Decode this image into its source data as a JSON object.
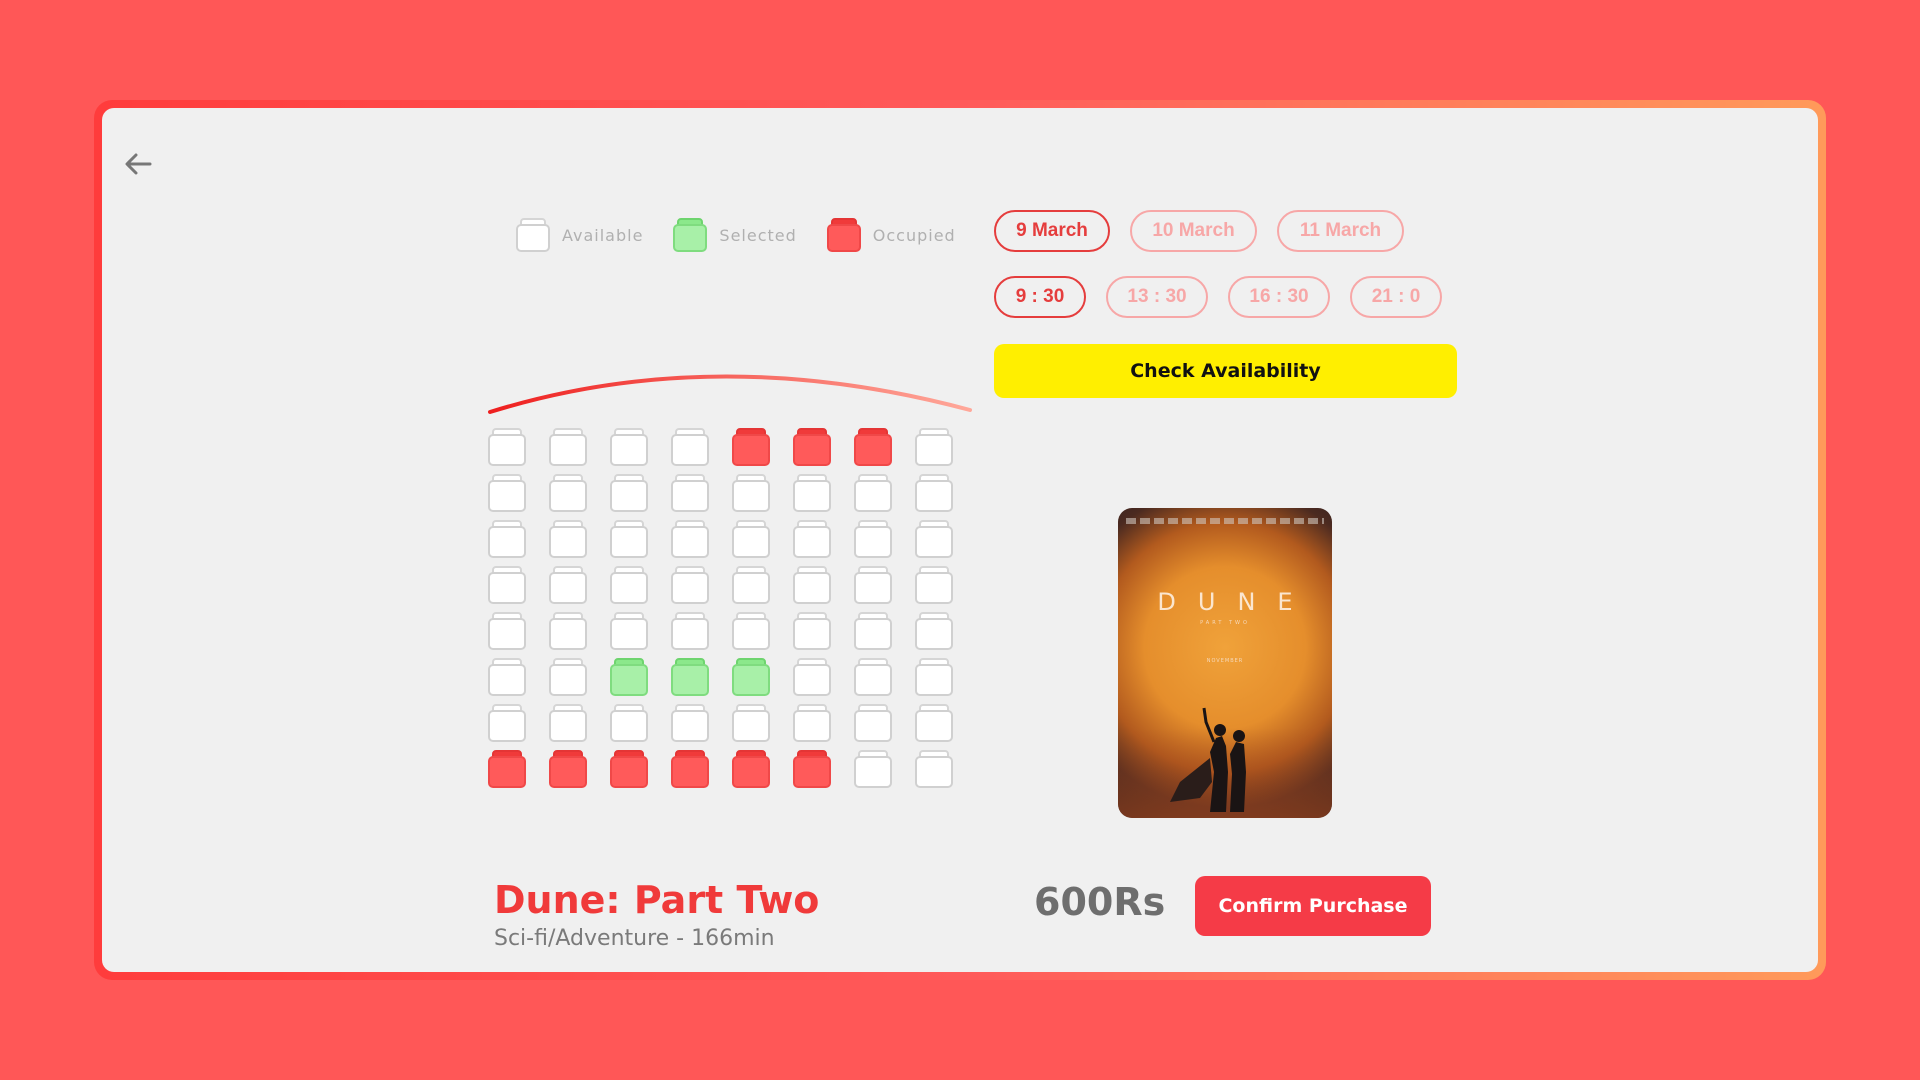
{
  "legend": {
    "available": "Available",
    "selected": "Selected",
    "occupied": "Occupied"
  },
  "dates": [
    {
      "label": "9 March",
      "active": true
    },
    {
      "label": "10 March",
      "active": false
    },
    {
      "label": "11 March",
      "active": false
    }
  ],
  "times": [
    {
      "label": "9 : 30",
      "active": true
    },
    {
      "label": "13 : 30",
      "active": false
    },
    {
      "label": "16 : 30",
      "active": false
    },
    {
      "label": "21 : 0",
      "active": false
    }
  ],
  "check_availability_label": "Check Availability",
  "seats": [
    [
      "available",
      "available",
      "available",
      "available",
      "occupied",
      "occupied",
      "occupied",
      "available"
    ],
    [
      "available",
      "available",
      "available",
      "available",
      "available",
      "available",
      "available",
      "available"
    ],
    [
      "available",
      "available",
      "available",
      "available",
      "available",
      "available",
      "available",
      "available"
    ],
    [
      "available",
      "available",
      "available",
      "available",
      "available",
      "available",
      "available",
      "available"
    ],
    [
      "available",
      "available",
      "available",
      "available",
      "available",
      "available",
      "available",
      "available"
    ],
    [
      "available",
      "available",
      "selected",
      "selected",
      "selected",
      "available",
      "available",
      "available"
    ],
    [
      "available",
      "available",
      "available",
      "available",
      "available",
      "available",
      "available",
      "available"
    ],
    [
      "occupied",
      "occupied",
      "occupied",
      "occupied",
      "occupied",
      "occupied",
      "available",
      "available"
    ]
  ],
  "poster": {
    "title": "DUNE",
    "subtitle": "PART TWO",
    "date_text": "NOVEMBER"
  },
  "movie": {
    "title": "Dune: Part Two",
    "meta": "Sci-fi/Adventure - 166min"
  },
  "price": "600Rs",
  "confirm_label": "Confirm Purchase",
  "colors": {
    "background": "#FF5757",
    "accent": "#F03A3A",
    "selected": "#8BE88B",
    "check_button": "#FFEF00"
  }
}
